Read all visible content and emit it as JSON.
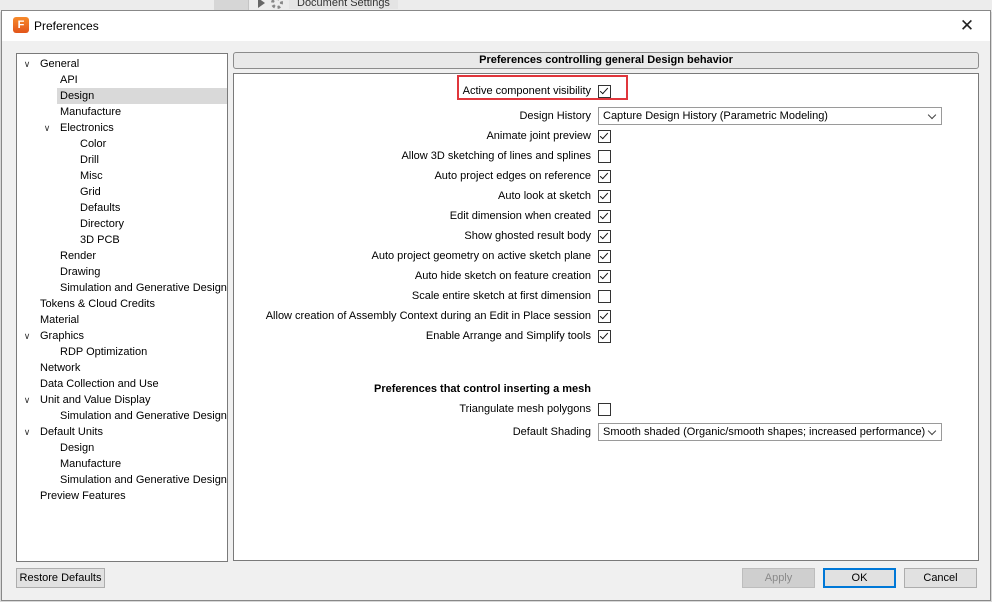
{
  "background": {
    "document_tab": "Document Settings"
  },
  "dialog": {
    "title": "Preferences",
    "close_glyph": "✕",
    "app_icon_letter": "F"
  },
  "tree": [
    {
      "label": "General",
      "depth": 0,
      "expander": "expanded"
    },
    {
      "label": "API",
      "depth": 1
    },
    {
      "label": "Design",
      "depth": 1,
      "selected": true
    },
    {
      "label": "Manufacture",
      "depth": 1
    },
    {
      "label": "Electronics",
      "depth": 1,
      "expander": "expanded"
    },
    {
      "label": "Color",
      "depth": 2
    },
    {
      "label": "Drill",
      "depth": 2
    },
    {
      "label": "Misc",
      "depth": 2
    },
    {
      "label": "Grid",
      "depth": 2
    },
    {
      "label": "Defaults",
      "depth": 2
    },
    {
      "label": "Directory",
      "depth": 2
    },
    {
      "label": "3D PCB",
      "depth": 2
    },
    {
      "label": "Render",
      "depth": 1
    },
    {
      "label": "Drawing",
      "depth": 1
    },
    {
      "label": "Simulation and Generative Design",
      "depth": 1
    },
    {
      "label": "Tokens & Cloud Credits",
      "depth": 0
    },
    {
      "label": "Material",
      "depth": 0
    },
    {
      "label": "Graphics",
      "depth": 0,
      "expander": "expanded"
    },
    {
      "label": "RDP Optimization",
      "depth": 1
    },
    {
      "label": "Network",
      "depth": 0
    },
    {
      "label": "Data Collection and Use",
      "depth": 0
    },
    {
      "label": "Unit and Value Display",
      "depth": 0,
      "expander": "expanded"
    },
    {
      "label": "Simulation and Generative Design",
      "depth": 1
    },
    {
      "label": "Default Units",
      "depth": 0,
      "expander": "expanded"
    },
    {
      "label": "Design",
      "depth": 1
    },
    {
      "label": "Manufacture",
      "depth": 1
    },
    {
      "label": "Simulation and Generative Design",
      "depth": 1
    },
    {
      "label": "Preview Features",
      "depth": 0
    }
  ],
  "panel": {
    "header": "Preferences controlling general Design behavior",
    "design_history": {
      "label": "Design History",
      "value": "Capture Design History (Parametric Modeling)"
    },
    "options": [
      {
        "label": "Active component visibility",
        "checked": true,
        "highlighted": true
      },
      {
        "label": "Animate joint preview",
        "checked": true
      },
      {
        "label": "Allow 3D sketching of lines and splines",
        "checked": false
      },
      {
        "label": "Auto project edges on reference",
        "checked": true
      },
      {
        "label": "Auto look at sketch",
        "checked": true
      },
      {
        "label": "Edit dimension when created",
        "checked": true
      },
      {
        "label": "Show ghosted result body",
        "checked": true
      },
      {
        "label": "Auto project geometry on active sketch plane",
        "checked": true
      },
      {
        "label": "Auto hide sketch on feature creation",
        "checked": true
      },
      {
        "label": "Scale entire sketch at first dimension",
        "checked": false
      },
      {
        "label": "Allow creation of Assembly Context during an Edit in Place session",
        "checked": true
      },
      {
        "label": "Enable Arrange and Simplify tools",
        "checked": true
      }
    ],
    "mesh": {
      "title": "Preferences that control inserting a mesh",
      "triangulate": {
        "label": "Triangulate mesh polygons",
        "checked": false
      },
      "shading": {
        "label": "Default Shading",
        "value": "Smooth shaded (Organic/smooth shapes; increased performance)"
      }
    }
  },
  "buttons": {
    "restore": "Restore Defaults",
    "apply": "Apply",
    "ok": "OK",
    "cancel": "Cancel"
  },
  "colors": {
    "highlight": "#e0363c",
    "ok_border": "#0078d7",
    "app_icon": "#f26b1d"
  }
}
